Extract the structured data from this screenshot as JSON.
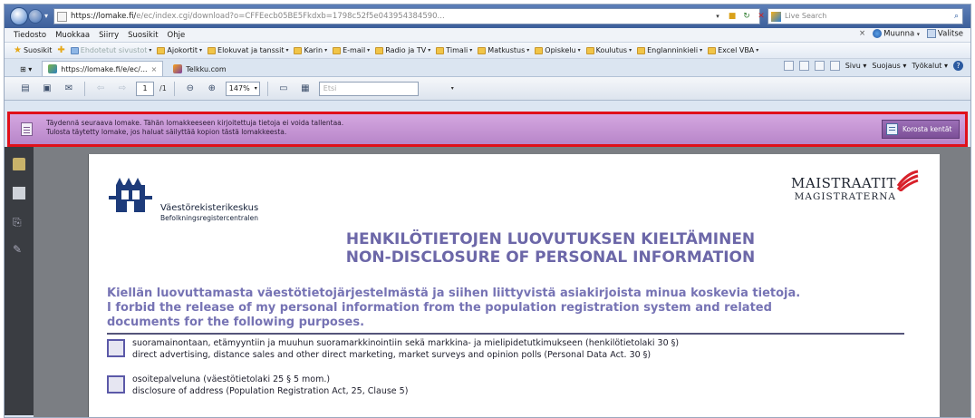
{
  "browser": {
    "url_main": "https://lomake.fi/",
    "url_rest": "e/ec/index.cgi/download?o=CFFEecb05BE5Fkdxb=1798c52f5e043954384590...",
    "search_placeholder": "Live Search"
  },
  "menu": {
    "items": [
      "Tiedosto",
      "Muokkaa",
      "Siirry",
      "Suosikit",
      "Ohje"
    ],
    "muunna": "Muunna",
    "valitse": "Valitse"
  },
  "favorites": {
    "suosikit": "Suosikit",
    "items": [
      {
        "label": "Ehdotetut sivustot",
        "dim": true
      },
      {
        "label": "Ajokortit",
        "dim": false
      },
      {
        "label": "Elokuvat ja tanssit",
        "dim": false
      },
      {
        "label": "Karin",
        "dim": false
      },
      {
        "label": "E-mail",
        "dim": false
      },
      {
        "label": "Radio ja TV",
        "dim": false
      },
      {
        "label": "Timali",
        "dim": false
      },
      {
        "label": "Matkustus",
        "dim": false
      },
      {
        "label": "Opiskelu",
        "dim": false
      },
      {
        "label": "Koulutus",
        "dim": false
      },
      {
        "label": "Englanninkieli",
        "dim": false
      },
      {
        "label": "Excel VBA",
        "dim": false
      }
    ]
  },
  "tabs": {
    "active": "https://lomake.fi/e/ec/...",
    "second": "Telkku.com",
    "commands": {
      "sivu": "Sivu",
      "suojaus": "Suojaus",
      "tyokalut": "Työkalut"
    }
  },
  "reader": {
    "page_current": "1",
    "page_total": "/1",
    "zoom": "147%",
    "find_placeholder": "Etsi"
  },
  "form_bar": {
    "line1": "Täydennä seuraava lomake. Tähän lomakkeeseen kirjoitettuja tietoja ei voida tallentaa.",
    "line2": "Tulosta täytetty lomake, jos haluat säilyttää kopion tästä lomakkeesta.",
    "button": "Korosta kentät"
  },
  "document": {
    "org_fi": "Väestörekisterikeskus",
    "org_sv": "Befolkningsregistercentralen",
    "maist_fi": "MAISTRAATIT",
    "maist_sv": "MAGISTRATERNA",
    "title_fi": "HENKILÖTIETOJEN LUOVUTUKSEN KIELTÄMINEN",
    "title_en": "NON-DISCLOSURE OF PERSONAL INFORMATION",
    "intro_fi": "Kiellän luovuttamasta väestötietojärjestelmästä ja siihen liittyvistä asiakirjoista minua koskevia tietoja.",
    "intro_en1": "I forbid the release of my personal information from the population registration system and related",
    "intro_en2": "documents for the following purposes.",
    "opt1_fi": "suoramainontaan, etämyyntiin ja muuhun suoramarkkinointiin sekä markkina- ja mielipidetutkimukseen (henkilötietolaki 30 §)",
    "opt1_en": "direct advertising, distance sales and other direct marketing, market surveys and opinion polls (Personal Data Act. 30 §)",
    "opt2_fi": "osoitepalveluna (väestötietolaki 25 § 5 mom.)",
    "opt2_en": "disclosure of address (Population Registration Act,   25, Clause 5)"
  }
}
